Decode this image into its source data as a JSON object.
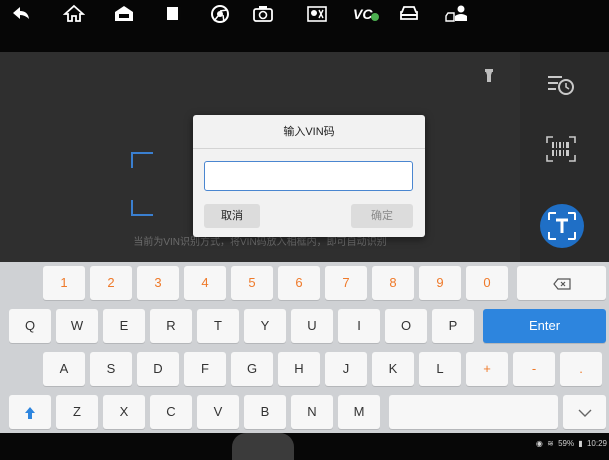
{
  "dialog": {
    "title": "输入VIN码",
    "input_value": "",
    "cancel_label": "取消",
    "ok_label": "确定"
  },
  "scanner": {
    "hint": "当前为VIN识别方式，将VIN码放入相框内，即可自动识别"
  },
  "keyboard": {
    "row1": [
      "1",
      "2",
      "3",
      "4",
      "5",
      "6",
      "7",
      "8",
      "9",
      "0"
    ],
    "row2": [
      "Q",
      "W",
      "E",
      "R",
      "T",
      "Y",
      "U",
      "I",
      "O",
      "P"
    ],
    "row3": [
      "A",
      "S",
      "D",
      "F",
      "G",
      "H",
      "J",
      "K",
      "L",
      "+",
      "-",
      "."
    ],
    "row4": [
      "Z",
      "X",
      "C",
      "V",
      "B",
      "N",
      "M"
    ],
    "enter_label": "Enter",
    "accent_color": "#ef7a2a",
    "enter_color": "#2d85de"
  },
  "status_bar": {
    "battery": "59%",
    "time": "10:29"
  },
  "nav_icons": [
    "back-icon",
    "home-icon",
    "car-house-icon",
    "recent-apps-icon",
    "chrome-icon",
    "camera-icon",
    "screenshot-icon",
    "vci-icon",
    "car-icon",
    "user-car-icon"
  ]
}
